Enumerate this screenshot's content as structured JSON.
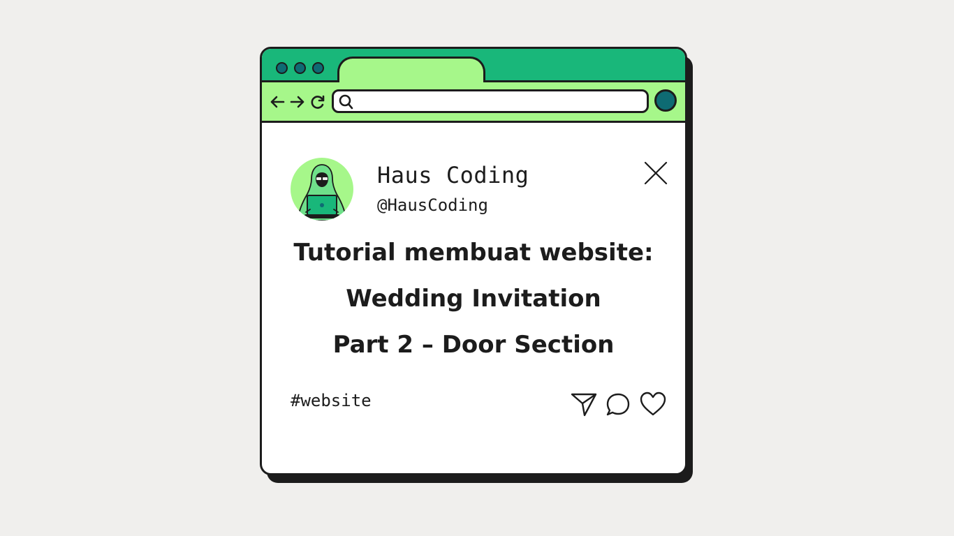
{
  "browser": {
    "window_controls": [
      "dot",
      "dot",
      "dot"
    ],
    "nav": {
      "back_icon": "arrow-left-icon",
      "forward_icon": "arrow-right-icon",
      "reload_icon": "reload-icon"
    },
    "search": {
      "icon": "search-icon",
      "value": ""
    },
    "profile_icon": "profile-circle"
  },
  "post": {
    "author": {
      "name": "Haus Coding",
      "handle": "@HausCoding"
    },
    "title_lines": [
      "Tutorial membuat website:",
      "Wedding Invitation",
      "Part 2 – Door Section"
    ],
    "hashtag": "#website",
    "actions": [
      "send-icon",
      "comment-icon",
      "heart-icon"
    ]
  },
  "colors": {
    "background": "#f0efed",
    "titlebar": "#19b77a",
    "toolbar": "#a6f78a",
    "accent_dark": "#0e6b73",
    "ink": "#1c1c1c"
  }
}
